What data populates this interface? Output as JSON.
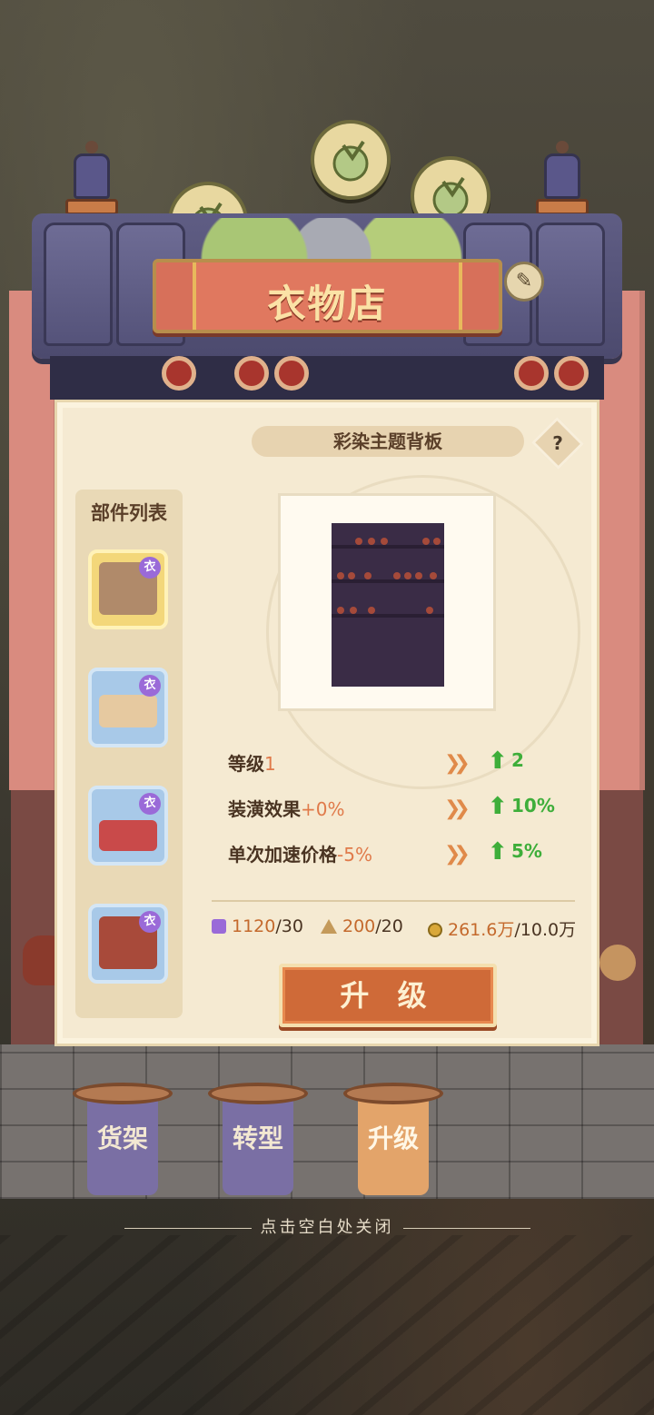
{
  "shop": {
    "title": "衣物店"
  },
  "item": {
    "name": "彩染主题背板"
  },
  "parts": {
    "title": "部件列表",
    "badge": "衣",
    "items": [
      {
        "badge": "衣",
        "selected": true
      },
      {
        "badge": "衣",
        "selected": false
      },
      {
        "badge": "衣",
        "selected": false
      },
      {
        "badge": "衣",
        "selected": false
      }
    ]
  },
  "stats": [
    {
      "label": "等级",
      "current": "1",
      "delta": "",
      "next": "2"
    },
    {
      "label": "装潢效果",
      "current": "",
      "delta": "+0%",
      "next": "10%"
    },
    {
      "label": "单次加速价格",
      "current": "",
      "delta": "-5%",
      "next": "5%"
    }
  ],
  "costs": [
    {
      "icon": "purple-token-icon",
      "have": "1120",
      "need": "/30"
    },
    {
      "icon": "triangle-material-icon",
      "have": "200",
      "need": "/20"
    },
    {
      "icon": "coin-icon",
      "have": "261.6万",
      "need": "/10.0万"
    }
  ],
  "upgrade_button": "升 级",
  "tabs": [
    {
      "label": "货架",
      "active": false
    },
    {
      "label": "转型",
      "active": false
    },
    {
      "label": "升级",
      "active": true
    }
  ],
  "close_hint": "点击空白处关闭",
  "colors": {
    "accent": "#cf6a38",
    "panel": "#f5ead2",
    "up_green": "#3eae3a",
    "tab_purple": "#7a6fa4",
    "tab_active": "#e3a46a"
  }
}
